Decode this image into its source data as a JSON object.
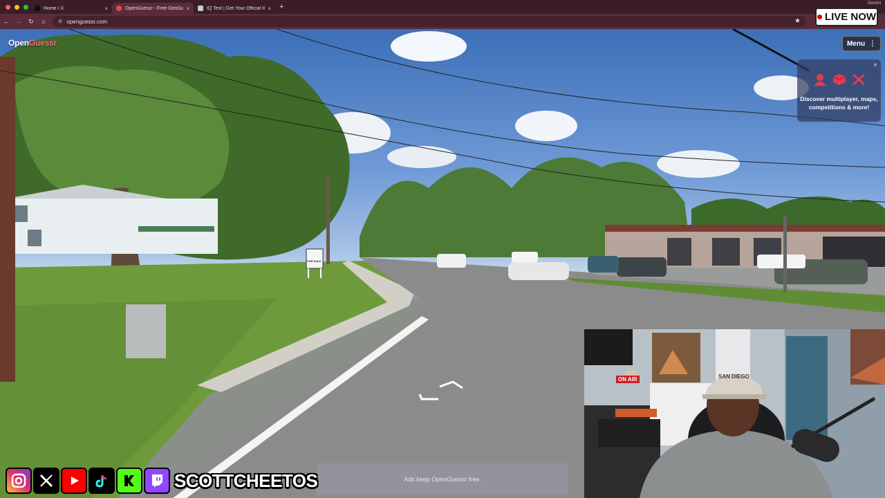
{
  "browser": {
    "tabs": [
      {
        "title": "Home / X",
        "active": false,
        "favicon_color": "#111111"
      },
      {
        "title": "OpenGuessr - Free GeoGuessr",
        "active": true,
        "favicon_color": "#e8475a"
      },
      {
        "title": "IQ Test | Get Your Official IQ",
        "active": false,
        "favicon_color": "#cccccc"
      }
    ],
    "tab_close_glyph": "×",
    "new_tab_glyph": "+",
    "url": "openguessr.com",
    "profile_label": "Gemini"
  },
  "game": {
    "logo_main": "Open",
    "logo_accent": "Guessr",
    "menu_label": "Menu",
    "promo_text": "Discover multiplayer, maps, competitions & more!",
    "promo_close": "×",
    "ads_text": "Ads keep OpenGuessr free.",
    "street_sign_text": "FOR SALE"
  },
  "stream_overlay": {
    "live_label": "LIVE NOW",
    "handle": "SCOTTCHEETOS",
    "on_air_label": "ON AIR",
    "cap_text": "SAN DIEGO",
    "social_icons": [
      "instagram-icon",
      "x-icon",
      "youtube-icon",
      "tiktok-icon",
      "kick-icon",
      "twitch-icon"
    ]
  },
  "colors": {
    "chrome_dark": "#3a1d28",
    "chrome_mid": "#5a2c3b",
    "accent_red": "#e8475a"
  }
}
